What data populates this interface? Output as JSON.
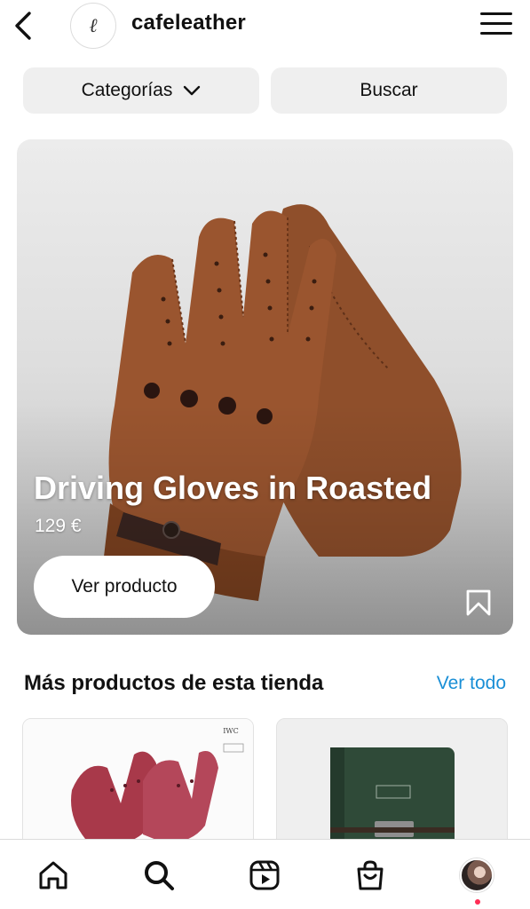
{
  "header": {
    "account_name": "cafeleather",
    "logo_glyph": "ℓ",
    "back_icon": "chevron-left-icon",
    "menu_icon": "hamburger-menu-icon"
  },
  "filters": {
    "categories_label": "Categorías",
    "search_label": "Buscar"
  },
  "featured": {
    "title": "Driving Gloves in Roasted",
    "price": "129 €",
    "cta_label": "Ver producto",
    "save_icon": "bookmark-icon"
  },
  "more": {
    "section_title": "Más productos de esta tienda",
    "see_all_label": "Ver todo",
    "products": [
      {
        "image": "red-leather-gloves",
        "brand_text": "IWC"
      },
      {
        "image": "green-leather-notebook"
      }
    ]
  },
  "bottom_nav": {
    "items": [
      "home-icon",
      "search-icon",
      "reels-icon",
      "shop-bag-icon",
      "profile-avatar"
    ],
    "notification_dot_color": "#ff2d55"
  },
  "colors": {
    "accent": "#1a8fd6",
    "pill_bg": "#efefef",
    "leather": "#8a4a26"
  }
}
